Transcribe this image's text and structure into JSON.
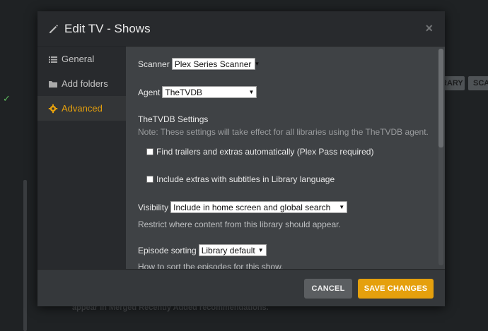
{
  "background": {
    "buttons": [
      "RARY",
      "SCA"
    ],
    "footer_text": "appear in Merged Recently Added recommendations."
  },
  "modal": {
    "title": "Edit TV - Shows",
    "close_glyph": "×",
    "sidebar": [
      {
        "label": "General",
        "icon": "list-icon"
      },
      {
        "label": "Add folders",
        "icon": "folder-icon"
      },
      {
        "label": "Advanced",
        "icon": "gear-icon",
        "active": true
      }
    ],
    "scanner": {
      "label": "Scanner",
      "value": "Plex Series Scanner"
    },
    "agent": {
      "label": "Agent",
      "value": "TheTVDB"
    },
    "tvdb": {
      "heading": "TheTVDB Settings",
      "note": "Note: These settings will take effect for all libraries using the TheTVDB agent.",
      "trailers_label": "Find trailers and extras automatically (Plex Pass required)",
      "subtitles_label": "Include extras with subtitles in Library language"
    },
    "visibility": {
      "label": "Visibility",
      "value": "Include in home screen and global search",
      "help": "Restrict where content from this library should appear."
    },
    "episode_sorting": {
      "label": "Episode sorting",
      "value": "Library default",
      "help": "How to sort the episodes for this show."
    },
    "footer": {
      "cancel_label": "CANCEL",
      "save_label": "SAVE CHANGES"
    }
  },
  "colors": {
    "accent": "#e5a00d",
    "modal_bg": "#282a2d",
    "content_bg": "#3f4245"
  }
}
